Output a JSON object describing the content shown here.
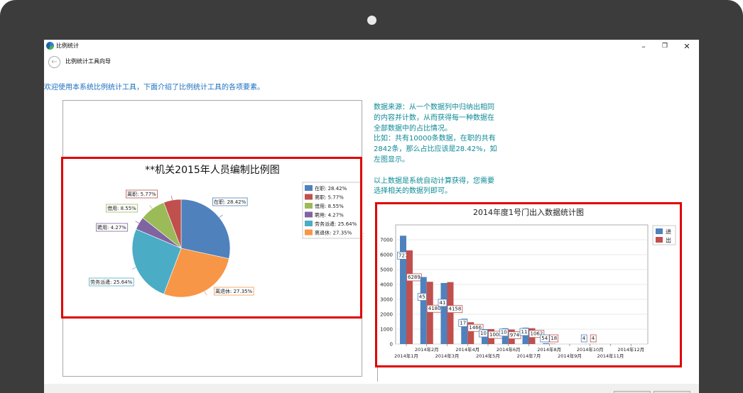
{
  "window": {
    "title": "比例统计",
    "minimize": "–",
    "restore": "❐",
    "close": "✕"
  },
  "wizard": {
    "title": "比例统计工具向导",
    "back_icon": "arrow-left-icon"
  },
  "intro": "欢迎使用本系统比例统计工具，下面介绍了比例统计工具的各项要素。",
  "description": {
    "text": "数据来源：从一个数据列中归纳出相同\n的内容并计数，从而获得每一种数据在\n全部数据中的占比情况。\n比如：共有10000条数据，在职的共有\n2842条，那么占比应该是28.42%，如\n左图显示。\n\n以上数据是系统自动计算获得，您需要\n选择相关的数据列即可。"
  },
  "chart_data": [
    {
      "type": "pie",
      "title": "**机关2015年人员编制比例图",
      "categories": [
        "在职",
        "离退休",
        "劳务派遣",
        "聘用",
        "借用",
        "离职"
      ],
      "values": [
        28.42,
        27.35,
        25.64,
        4.27,
        8.55,
        5.77
      ],
      "data_labels": [
        "在职: 28.42%",
        "离退休: 27.35%",
        "劳务派遣: 25.64%",
        "聘用: 4.27%",
        "借用: 8.55%",
        "离职: 5.77%"
      ],
      "colors": [
        "#4f81bd",
        "#f79646",
        "#4bacc6",
        "#8064a2",
        "#9bbb59",
        "#c0504d"
      ],
      "legend": {
        "position": "right",
        "items": [
          {
            "label": "在职: 28.42%",
            "color": "#4f81bd"
          },
          {
            "label": "离职: 5.77%",
            "color": "#c0504d"
          },
          {
            "label": "借用: 8.55%",
            "color": "#9bbb59"
          },
          {
            "label": "聘用: 4.27%",
            "color": "#8064a2"
          },
          {
            "label": "劳务派遣: 25.64%",
            "color": "#4bacc6"
          },
          {
            "label": "离退休: 27.35%",
            "color": "#f79646"
          }
        ]
      }
    },
    {
      "type": "bar",
      "title": "2014年度1号门出入数据统计图",
      "categories": [
        "2014年1月",
        "2014年2月",
        "2014年3月",
        "2014年4月",
        "2014年5月",
        "2014年6月",
        "2014年7月",
        "2014年8月",
        "2014年9月",
        "2014年10月",
        "2014年11月",
        "2014年12月"
      ],
      "series": [
        {
          "name": "进",
          "color": "#4f81bd",
          "values": [
            7271,
            4500,
            4100,
            1700,
            1000,
            1060,
            1100,
            54,
            0,
            4,
            0,
            0
          ]
        },
        {
          "name": "出",
          "color": "#c0504d",
          "values": [
            6289,
            4180,
            4158,
            1466,
            1001,
            974,
            1062,
            18,
            0,
            4,
            0,
            0
          ]
        }
      ],
      "data_labels": [
        [
          "7271",
          "45",
          "41",
          "17",
          "10",
          "10",
          "11",
          "54",
          "",
          "4",
          "",
          ""
        ],
        [
          "6289",
          "4180",
          "4158",
          "1466",
          "1001",
          "974",
          "1062",
          "18",
          "",
          "4",
          "",
          ""
        ]
      ],
      "yticks": [
        "0",
        "1000",
        "2000",
        "3000",
        "4000",
        "5000",
        "6000",
        "7000"
      ],
      "ylim": [
        0,
        8000
      ],
      "grid": true,
      "legend": "top-right"
    }
  ]
}
